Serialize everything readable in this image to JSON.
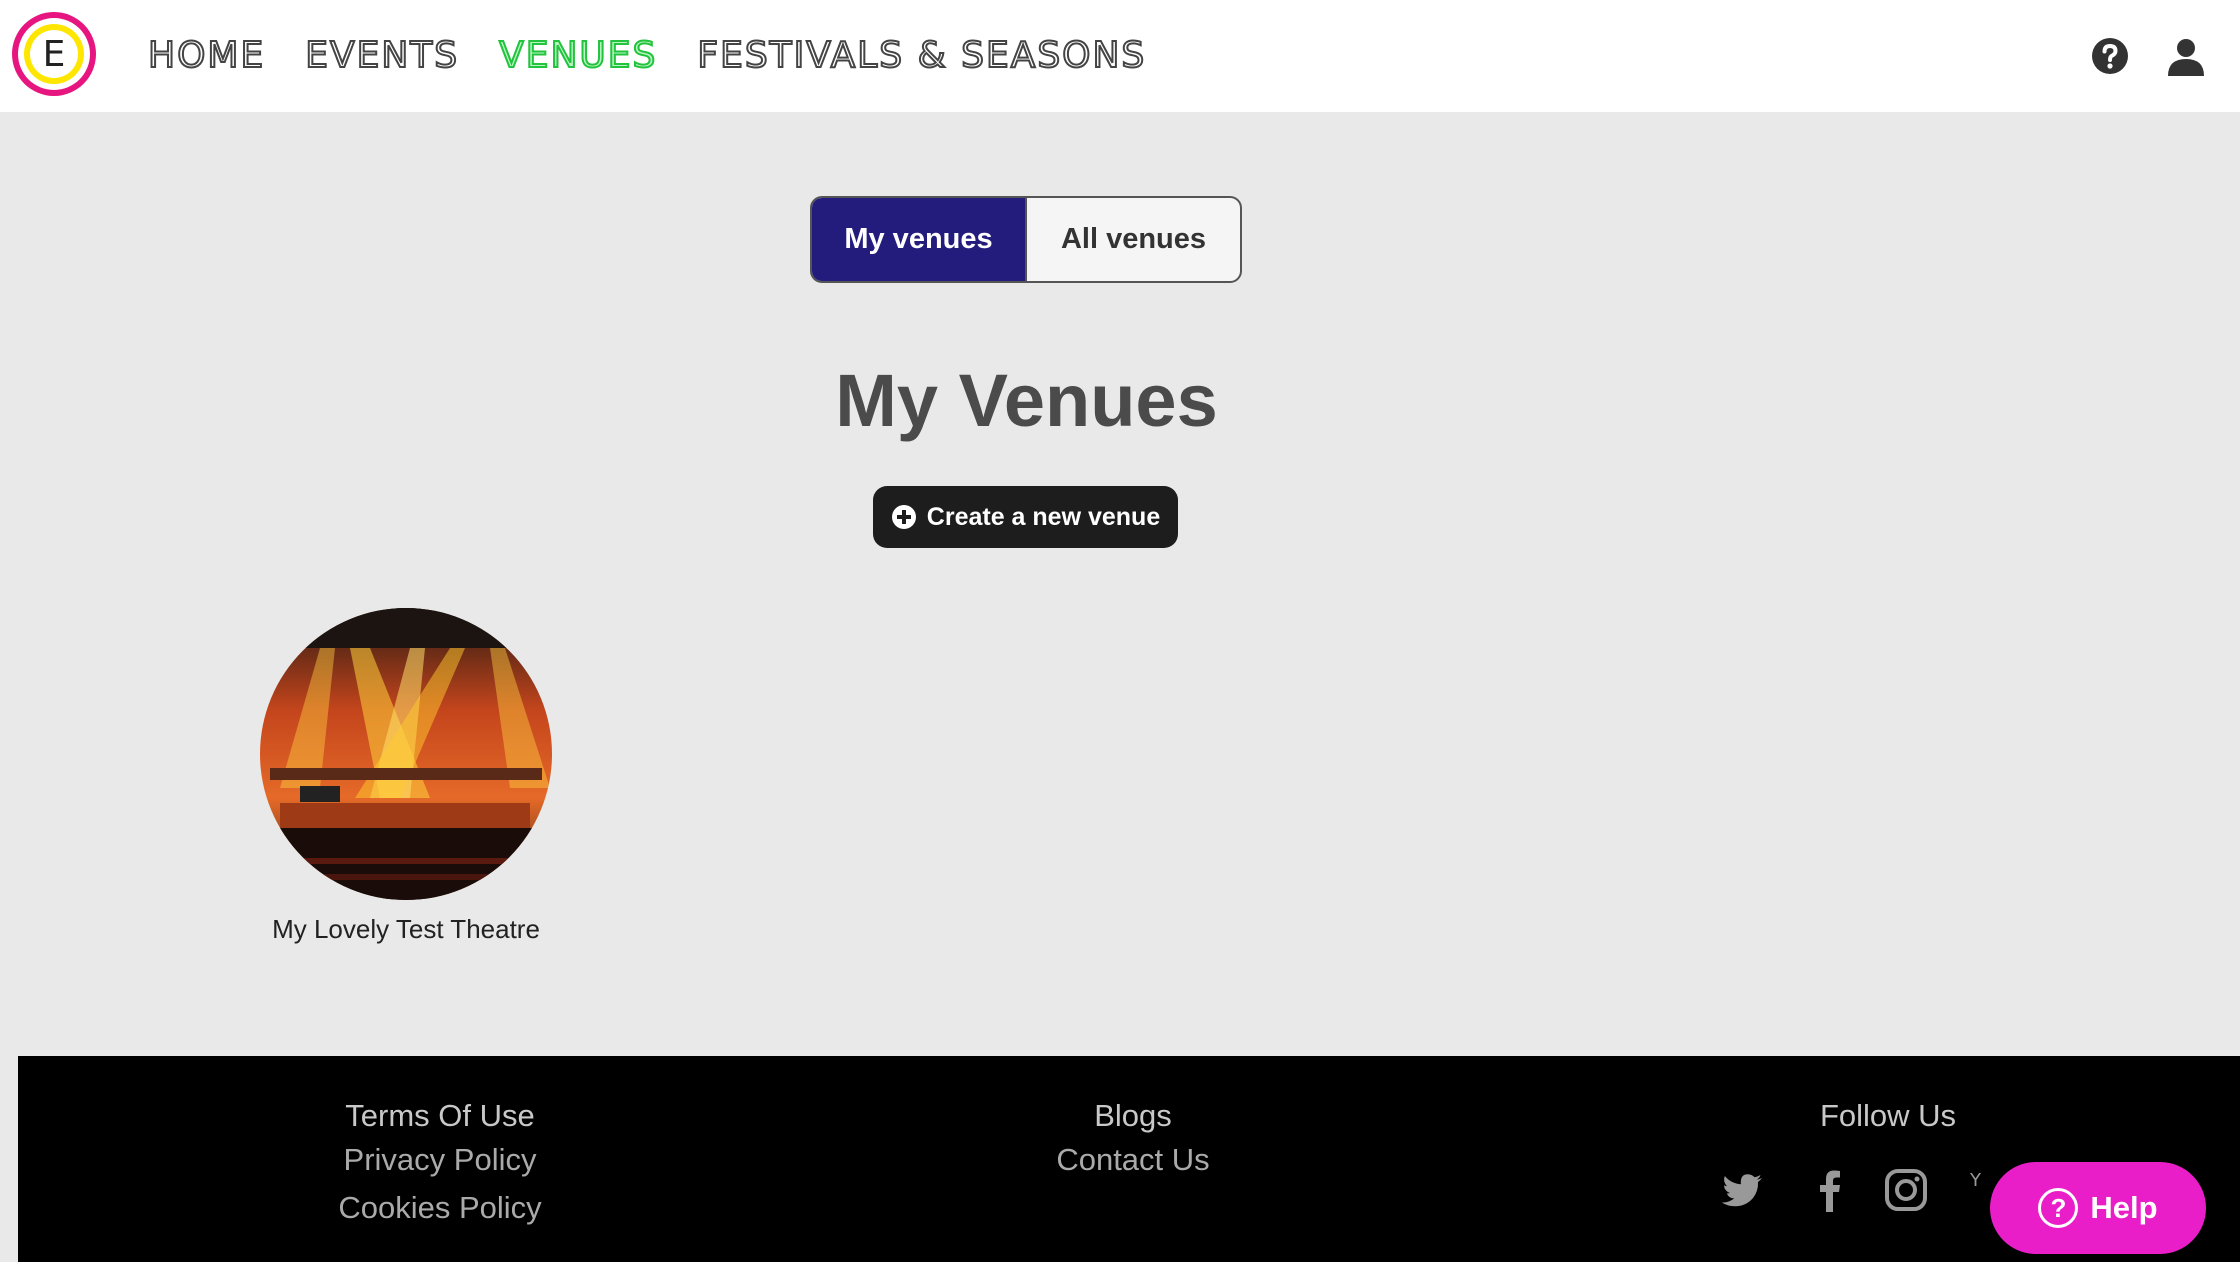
{
  "logo": {
    "letter": "E"
  },
  "nav": {
    "items": [
      {
        "label": "HOME",
        "active": false
      },
      {
        "label": "EVENTS",
        "active": false
      },
      {
        "label": "VENUES",
        "active": true
      },
      {
        "label": "FESTIVALS & SEASONS",
        "active": false
      }
    ]
  },
  "header_icons": [
    "question-circle-icon",
    "user-icon"
  ],
  "toggle": {
    "mine": "My venues",
    "all": "All venues",
    "selected": "My venues"
  },
  "main": {
    "title": "My Venues",
    "create_button": "Create a new venue",
    "venues": [
      {
        "name": "My Lovely Test Theatre"
      }
    ]
  },
  "footer": {
    "col1": {
      "head": "Terms Of Use",
      "links": [
        "Privacy Policy",
        "Cookies Policy"
      ]
    },
    "col2": {
      "head": "Blogs",
      "links": [
        "Contact Us"
      ]
    },
    "col3": {
      "head": "Follow Us",
      "socials": [
        "twitter-icon",
        "facebook-icon",
        "instagram-icon",
        "youtube-icon"
      ]
    }
  },
  "help_button": {
    "label": "Help"
  },
  "colors": {
    "accent_active": "#22c33d",
    "toggle_active": "#231c7d",
    "help_button": "#e91ec8",
    "logo_ring": "#e6157f",
    "logo_inner": "#ffe600"
  }
}
